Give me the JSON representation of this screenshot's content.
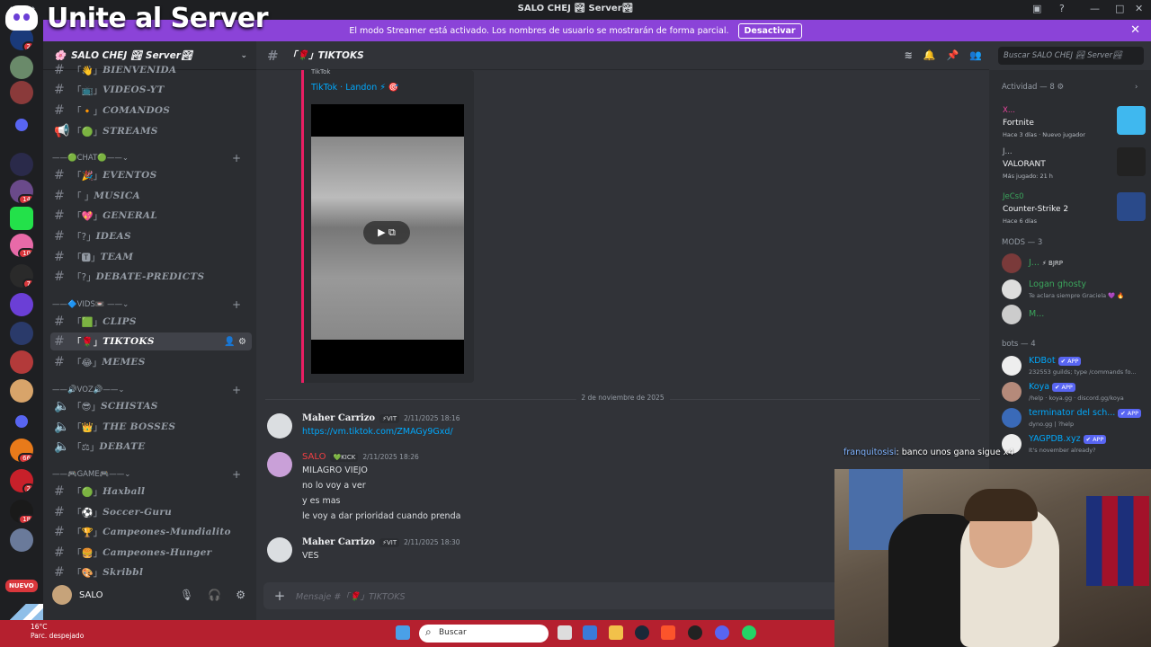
{
  "window": {
    "title": "SALO CHEJ 🏞 Server🏞"
  },
  "overlay": {
    "brand_text": "Unite al Server"
  },
  "banner": {
    "text": "El modo Streamer está activado. Los nombres de usuario se mostrarán de forma parcial.",
    "button": "Desactivar"
  },
  "guilds": {
    "nuevo_label": "NUEVO"
  },
  "server": {
    "name": "SALO CHEJ 🏞 Server🏞"
  },
  "channels": {
    "bienvenida": "BIENVENIDA",
    "videos": "VIDEOS-YT",
    "comandos": "COMANDOS",
    "streams": "STREAMS",
    "cat_chat": "CHAT",
    "eventos": "EVENTOS",
    "musica": "MUSICA",
    "general": "GENERAL",
    "ideas": "IDEAS",
    "team": "TEAM",
    "debate_predicts": "DEBATE-PREDICTS",
    "cat_vids": "VIDS",
    "clips": "CLIPS",
    "tiktoks": "TIKTOKS",
    "memes": "MEMES",
    "cat_voz": "VOZ",
    "schistas": "SCHISTAS",
    "the_bosses": "THE BOSSES",
    "debate": "DEBATE",
    "cat_game": "GAME",
    "haxball": "Haxball",
    "soccer_guru": "Soccer-Guru",
    "mundialito": "Campeones-Mundialito",
    "hunger": "Campeones-Hunger",
    "skribbl": "Skribbl"
  },
  "user": {
    "name": "SALO"
  },
  "channel_header": {
    "name": "TIKTOKS",
    "search_placeholder": "Buscar SALO CHEJ 🏞 Server🏞"
  },
  "embed": {
    "provider": "TikTok",
    "title": "TikTok · Landon ⚡ 🎯"
  },
  "date_divider": "2 de noviembre de 2025",
  "messages": [
    {
      "author": "Maher Carrizo",
      "tag": "⚡VIT",
      "time": "2/11/2025 18:16",
      "lines": [
        "https://vm.tiktok.com/ZMAGy9Gxd/"
      ]
    },
    {
      "author": "SALO",
      "tag": "💚KICK",
      "time": "2/11/2025 18:26",
      "lines": [
        "MILAGRO VIEJO",
        "no lo voy a ver",
        "y es mas",
        "le voy a dar prioridad cuando prenda"
      ]
    },
    {
      "author": "Maher Carrizo",
      "tag": "⚡VIT",
      "time": "2/11/2025 18:30",
      "lines": [
        "VES"
      ]
    }
  ],
  "composer": {
    "placeholder": "Mensaje #「🌹」TIKTOKS"
  },
  "activity": {
    "header": "Actividad — 8",
    "items": [
      {
        "who": "X...",
        "game": "Fortnite",
        "sub": "Hace 3 días",
        "extra": "Nuevo jugador"
      },
      {
        "who": "J...",
        "game": "VALORANT",
        "sub": "Más jugado: 21 h"
      },
      {
        "who": "JeCs0",
        "game": "Counter-Strike 2",
        "sub": "Hace 6 días"
      }
    ]
  },
  "mods": {
    "header": "MODS — 3",
    "items": [
      {
        "name": "J...",
        "status": "⚡ BJRP"
      },
      {
        "name": "Logan ghosty",
        "status": "Te aclara siempre Graciela 💜 🔥"
      },
      {
        "name": "M..."
      }
    ]
  },
  "bots": {
    "header": "bots — 4",
    "app_label": "✔ APP",
    "items": [
      {
        "name": "KDBot",
        "status": "232553 guilds; type /commands fo..."
      },
      {
        "name": "Koya",
        "status": "/help · koya.gg · discord.gg/koya"
      },
      {
        "name": "terminator del sch...",
        "status": "dyno.gg | ?help"
      },
      {
        "name": "YAGPDB.xyz",
        "status": "It's november already?"
      }
    ]
  },
  "stream_chat": {
    "user": "franquitosisi",
    "text": ": banco unos gana sigue x4"
  },
  "taskbar": {
    "temp": "16°C",
    "weather": "Parc. despejado",
    "search": "Buscar"
  },
  "colors": {
    "accent": "#8b43d8",
    "taskbar": "#b5202f",
    "link": "#00a8fc",
    "online": "#3ba55c"
  }
}
